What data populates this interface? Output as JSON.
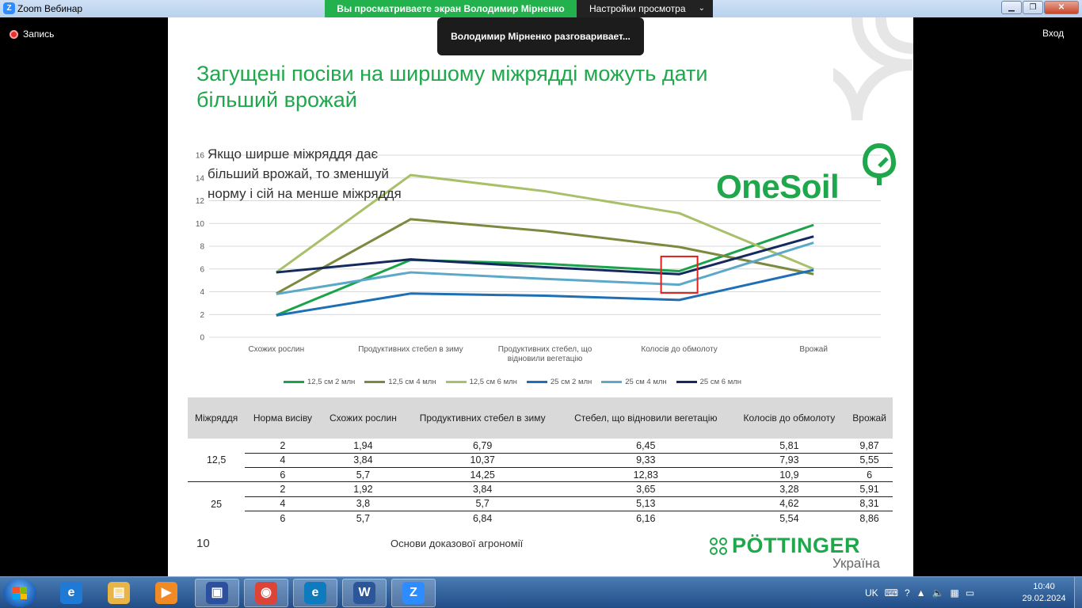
{
  "window": {
    "title": "Zoom Вебинар",
    "share_banner": "Вы просматриваете экран Володимир Мірненко",
    "view_settings": "Настройки просмотра"
  },
  "meeting": {
    "record_label": "Запись",
    "exit_label": "Вход",
    "speaker_tip": "Володимир Мірненко разговаривает..."
  },
  "slide": {
    "title": "Загущені посіви на ширшому міжрядді можуть дати більший врожай",
    "annotation": "Якщо ширше міжряддя дає більший врожай, то зменшуй норму і сій на менше міжряддя",
    "onesoil_logo": "OneSoil",
    "page_number": "10",
    "footer_text": "Основи доказової агрономії",
    "pottinger_logo": "PÖTTINGER",
    "pottinger_sub": "Україна"
  },
  "chart_data": {
    "type": "line",
    "categories": [
      "Схожих рослин",
      "Продуктивних стебел в зиму",
      "Продуктивних стебел, що відновили вегетацію",
      "Колосів до обмолоту",
      "Врожай"
    ],
    "ylim": [
      0,
      16
    ],
    "yticks": [
      "0",
      "2",
      "4",
      "6",
      "8",
      "10",
      "12",
      "14",
      "16"
    ],
    "grid": true,
    "legend_position": "bottom",
    "highlight_category": "Колосів до обмолоту",
    "series": [
      {
        "name": "12,5 см 2 млн",
        "color": "#1aa34a",
        "values": [
          1.94,
          6.79,
          6.45,
          5.81,
          9.87
        ]
      },
      {
        "name": "12,5 см 4 млн",
        "color": "#7c8a3f",
        "values": [
          3.84,
          10.37,
          9.33,
          7.93,
          5.55
        ]
      },
      {
        "name": "12,5 см 6 млн",
        "color": "#a9c06a",
        "values": [
          5.7,
          14.25,
          12.83,
          10.9,
          6
        ]
      },
      {
        "name": "25 см 2 млн",
        "color": "#1f6fb5",
        "values": [
          1.92,
          3.84,
          3.65,
          3.28,
          5.91
        ]
      },
      {
        "name": "25 см 4 млн",
        "color": "#5ba8c8",
        "values": [
          3.8,
          5.7,
          5.13,
          4.62,
          8.31
        ]
      },
      {
        "name": "25 см 6 млн",
        "color": "#142a5e",
        "values": [
          5.7,
          6.84,
          6.16,
          5.54,
          8.86
        ]
      }
    ]
  },
  "table": {
    "headers": [
      "Міжряддя",
      "Норма висіву",
      "Схожих рослин",
      "Продуктивних стебел в зиму",
      "Стебел, що відновили вегетацію",
      "Колосів до обмолоту",
      "Врожай"
    ],
    "groups": [
      {
        "spacing": "12,5",
        "rows": [
          [
            "2",
            "1,94",
            "6,79",
            "6,45",
            "5,81",
            "9,87"
          ],
          [
            "4",
            "3,84",
            "10,37",
            "9,33",
            "7,93",
            "5,55"
          ],
          [
            "6",
            "5,7",
            "14,25",
            "12,83",
            "10,9",
            "6"
          ]
        ]
      },
      {
        "spacing": "25",
        "rows": [
          [
            "2",
            "1,92",
            "3,84",
            "3,65",
            "3,28",
            "5,91"
          ],
          [
            "4",
            "3,8",
            "5,7",
            "5,13",
            "4,62",
            "8,31"
          ],
          [
            "6",
            "5,7",
            "6,84",
            "6,16",
            "5,54",
            "8,86"
          ]
        ]
      }
    ]
  },
  "taskbar": {
    "apps": [
      {
        "name": "internet-explorer",
        "color": "#1f7ad6",
        "glyph": "e"
      },
      {
        "name": "file-explorer",
        "color": "#e8b445",
        "glyph": "▤"
      },
      {
        "name": "media-player",
        "color": "#f08a24",
        "glyph": "▶"
      },
      {
        "name": "save-disk",
        "color": "#2c4f9e",
        "glyph": "▣"
      },
      {
        "name": "chrome",
        "color": "#db4437",
        "glyph": "◉"
      },
      {
        "name": "edge",
        "color": "#0f7bbf",
        "glyph": "e"
      },
      {
        "name": "word",
        "color": "#2b579a",
        "glyph": "W"
      },
      {
        "name": "zoom",
        "color": "#2d8cff",
        "glyph": "Z"
      }
    ],
    "language": "UK",
    "time": "10:40",
    "date": "29.02.2024"
  }
}
